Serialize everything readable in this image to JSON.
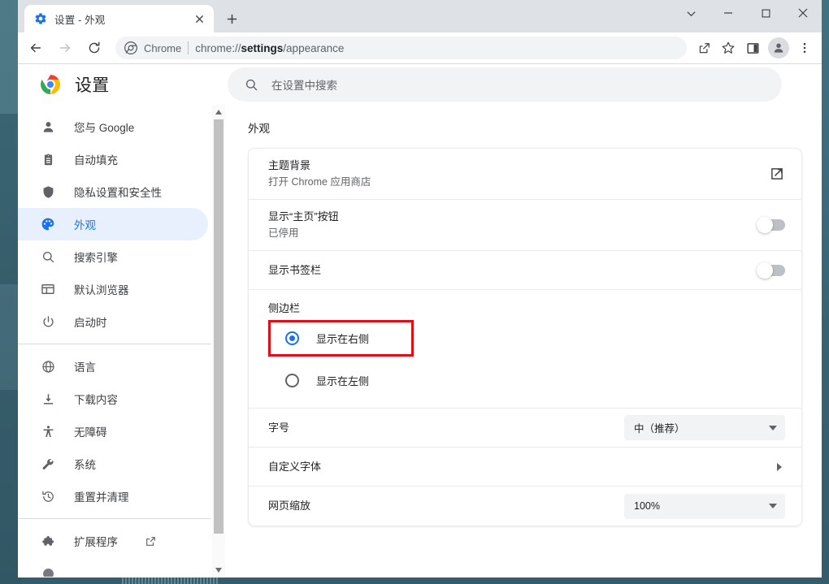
{
  "window": {
    "controls": [
      {
        "name": "chevron-down",
        "glyph": "⌄"
      },
      {
        "name": "minimize",
        "glyph": "–"
      },
      {
        "name": "maximize",
        "glyph": "□"
      },
      {
        "name": "close",
        "glyph": "✕"
      }
    ]
  },
  "tab": {
    "title": "设置 - 外观",
    "favicon": "settings-gear-icon",
    "close_label": "✕",
    "newtab_label": "+"
  },
  "toolbar": {
    "back": "←",
    "forward": "→",
    "reload": "⟳",
    "omnibox": {
      "scheme_label": "Chrome",
      "url_prefix": "chrome://",
      "url_bold": "settings",
      "url_suffix": "/appearance",
      "full_url": "chrome://settings/appearance"
    },
    "icons": [
      "share-icon",
      "bookmark-star-icon",
      "side-panel-icon",
      "profile-avatar",
      "three-dot-menu-icon"
    ]
  },
  "settings": {
    "title": "设置",
    "search": {
      "placeholder": "在设置中搜索",
      "value": ""
    },
    "sidebar": {
      "groups": [
        [
          {
            "icon": "person-icon",
            "label": "您与 Google",
            "active": false
          },
          {
            "icon": "clipboard-icon",
            "label": "自动填充",
            "active": false
          },
          {
            "icon": "shield-icon",
            "label": "隐私设置和安全性",
            "active": false
          },
          {
            "icon": "palette-icon",
            "label": "外观",
            "active": true
          },
          {
            "icon": "search-icon",
            "label": "搜索引擎",
            "active": false
          },
          {
            "icon": "browser-window-icon",
            "label": "默认浏览器",
            "active": false
          },
          {
            "icon": "power-icon",
            "label": "启动时",
            "active": false
          }
        ],
        [
          {
            "icon": "globe-icon",
            "label": "语言",
            "active": false
          },
          {
            "icon": "download-icon",
            "label": "下载内容",
            "active": false
          },
          {
            "icon": "accessibility-icon",
            "label": "无障碍",
            "active": false
          },
          {
            "icon": "wrench-icon",
            "label": "系统",
            "active": false
          },
          {
            "icon": "restore-icon",
            "label": "重置并清理",
            "active": false
          }
        ],
        [
          {
            "icon": "puzzle-icon",
            "label": "扩展程序",
            "active": false,
            "external": true
          }
        ]
      ]
    },
    "section_heading": "外观",
    "rows": {
      "theme": {
        "title": "主题背景",
        "subtitle": "打开 Chrome 应用商店",
        "control": "external-link-icon"
      },
      "home_button": {
        "title": "显示“主页”按钮",
        "subtitle": "已停用",
        "toggle_on": false
      },
      "bookmarks_bar": {
        "title": "显示书签栏",
        "toggle_on": false
      },
      "side_panel": {
        "title": "侧边栏",
        "options": [
          {
            "label": "显示在右侧",
            "selected": true,
            "highlighted": true
          },
          {
            "label": "显示在左侧",
            "selected": false,
            "highlighted": false
          }
        ]
      },
      "font_size": {
        "title": "字号",
        "value": "中（推荐）"
      },
      "custom_fonts": {
        "title": "自定义字体",
        "control": "chevron-right-icon"
      },
      "page_zoom": {
        "title": "网页缩放",
        "value": "100%"
      }
    }
  },
  "colors": {
    "accent": "#1a73e8",
    "highlight_box": "#e50914",
    "active_nav_bg": "#e8f0fe",
    "desktop": "#3d6a79",
    "tabstrip": "#dee1e6"
  }
}
